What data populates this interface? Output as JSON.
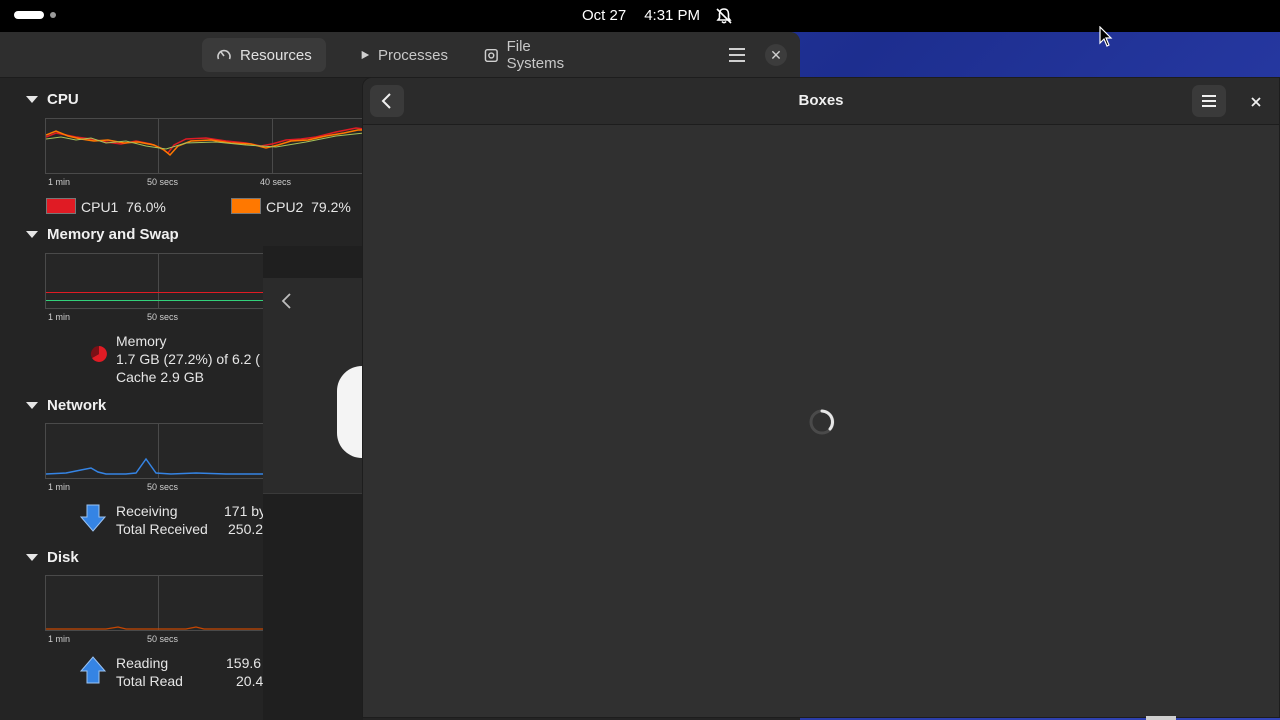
{
  "topbar": {
    "date": "Oct 27",
    "time": "4:31 PM",
    "icons": [
      "activities-icon",
      "notifications-off-icon",
      "network-wired-icon",
      "volume-icon",
      "power-icon"
    ]
  },
  "system_monitor": {
    "tabs": [
      {
        "label": "Resources",
        "icon": "gauge-icon",
        "active": true
      },
      {
        "label": "Processes",
        "icon": "play-icon",
        "active": false
      },
      {
        "label": "File Systems",
        "icon": "disk-icon",
        "active": false
      }
    ],
    "cpu": {
      "title": "CPU",
      "ticks": [
        "1 min",
        "50 secs",
        "40 secs"
      ],
      "cores": [
        {
          "name": "CPU1",
          "value": "76.0%",
          "color": "#e01b24"
        },
        {
          "name": "CPU2",
          "value": "79.2%",
          "color": "#ff7800"
        }
      ]
    },
    "memory": {
      "title": "Memory and Swap",
      "ticks": [
        "1 min",
        "50 secs"
      ],
      "label": "Memory",
      "usage": "1.7 GB (27.2%) of 6.2 (",
      "cache": "Cache 2.9 GB",
      "color": "#e01b24"
    },
    "network": {
      "title": "Network",
      "ticks": [
        "1 min",
        "50 secs"
      ],
      "receiving_label": "Receiving",
      "receiving_value": "171 by",
      "total_received_label": "Total Received",
      "total_received_value": "250.2"
    },
    "disk": {
      "title": "Disk",
      "ticks": [
        "1 min",
        "50 secs"
      ],
      "reading_label": "Reading",
      "reading_value": "159.6",
      "total_read_label": "Total Read",
      "total_read_value": "20.4"
    }
  },
  "boxes": {
    "title": "Boxes",
    "state": "loading"
  },
  "colors": {
    "accent_blue": "#3584e4",
    "wallpaper": "#2a3fae"
  }
}
